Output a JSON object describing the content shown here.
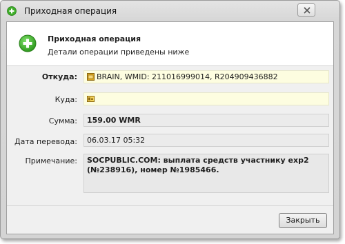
{
  "window": {
    "title": "Приходная операция"
  },
  "header": {
    "title": "Приходная операция",
    "subtitle": "Детали операции приведены ниже"
  },
  "form": {
    "from_label": "Откуда:",
    "from_value": "BRAIN, WMID: 211016999014, R204909436882",
    "to_label": "Куда:",
    "to_value": "",
    "amount_label": "Сумма:",
    "amount_value": "159.00 WMR",
    "date_label": "Дата перевода:",
    "date_value": "06.03.17 05:32",
    "note_label": "Примечание:",
    "note_value": "SOCPUBLIC.COM: выплата средств участнику exp2 (№238916), номер №1985466."
  },
  "buttons": {
    "close_label": "Закрыть"
  },
  "icons": {
    "title": "plus-circle-icon",
    "header": "plus-circle-icon",
    "from": "wallet-icon",
    "to": "id-card-icon",
    "close": "close-icon"
  },
  "colors": {
    "accent_green": "#3fae2a",
    "field_yellow": "#fdfde0"
  }
}
